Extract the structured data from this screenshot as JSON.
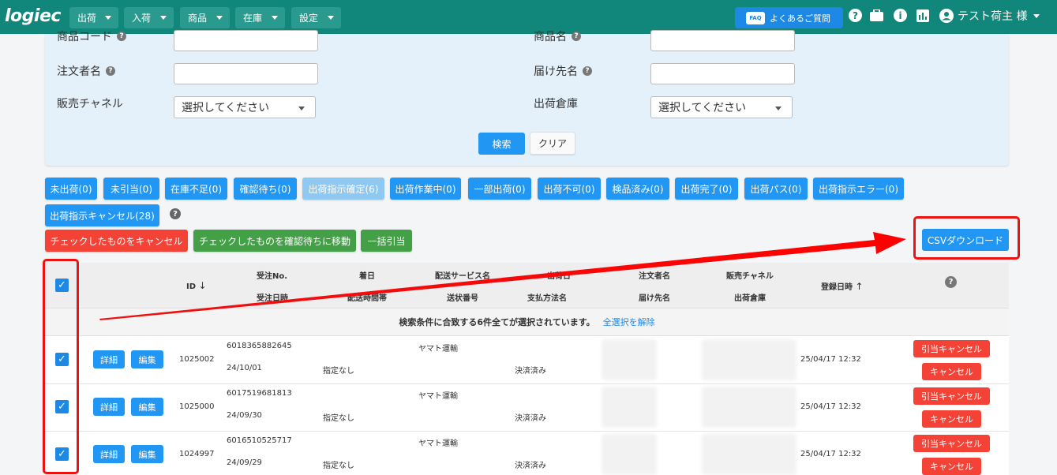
{
  "header": {
    "logo": "logiec",
    "nav": [
      "出荷",
      "入荷",
      "商品",
      "在庫",
      "設定"
    ],
    "faq_badge": "FAQ",
    "faq": "よくあるご質問",
    "user": "テスト荷主 様"
  },
  "search": {
    "product_code": "商品コード",
    "product_name": "商品名",
    "orderer": "注文者名",
    "recipient": "届け先名",
    "channel": "販売チャネル",
    "warehouse": "出荷倉庫",
    "select_placeholder": "選択してください",
    "search_btn": "検索",
    "clear_btn": "クリア"
  },
  "status_buttons": [
    "未出荷(0)",
    "未引当(0)",
    "在庫不足(0)",
    "確認待ち(0)",
    "出荷指示確定(6)",
    "出荷作業中(0)",
    "一部出荷(0)",
    "出荷不可(0)",
    "検品済み(0)",
    "出荷完了(0)",
    "出荷パス(0)",
    "出荷指示エラー(0)",
    "出荷指示キャンセル(28)"
  ],
  "actions": {
    "cancel_checked": "チェックしたものをキャンセル",
    "move_checked": "チェックしたものを確認待ちに移動",
    "bulk_allocate": "一括引当",
    "csv": "CSVダウンロード"
  },
  "table": {
    "headers": {
      "id": "ID",
      "order_no": "受注No.",
      "order_date": "受注日時",
      "arrival": "着日",
      "time_slot": "配送時間帯",
      "service": "配送サービス名",
      "tracking": "送状番号",
      "shipping": "出荷日",
      "payment": "支払方法名",
      "orderer": "注文者名",
      "recipient": "届け先名",
      "channel": "販売チャネル",
      "warehouse": "出荷倉庫",
      "registered": "登録日時",
      "help": "?"
    },
    "sort_down": "↓",
    "sort_up": "↑",
    "selection_msg": "検索条件に合致する6件全てが選択されています。",
    "deselect_all": "全選択を解除",
    "detail_label": "詳細",
    "edit_label": "編集",
    "release_label": "引当キャンセル",
    "cancel_label": "キャンセル",
    "rows": [
      {
        "id": "1025002",
        "order_no": "6018365882645",
        "order_date": "24/10/01",
        "time_slot": "指定なし",
        "service": "ヤマト運輸",
        "payment": "決済済み",
        "registered": "25/04/17 12:32"
      },
      {
        "id": "1025000",
        "order_no": "6017519681813",
        "order_date": "24/09/30",
        "time_slot": "指定なし",
        "service": "ヤマト運輸",
        "payment": "決済済み",
        "registered": "25/04/17 12:32"
      },
      {
        "id": "1024997",
        "order_no": "6016510525717",
        "order_date": "24/09/29",
        "time_slot": "指定なし",
        "service": "ヤマト運輸",
        "payment": "決済済み",
        "registered": "25/04/17 12:32"
      }
    ]
  }
}
